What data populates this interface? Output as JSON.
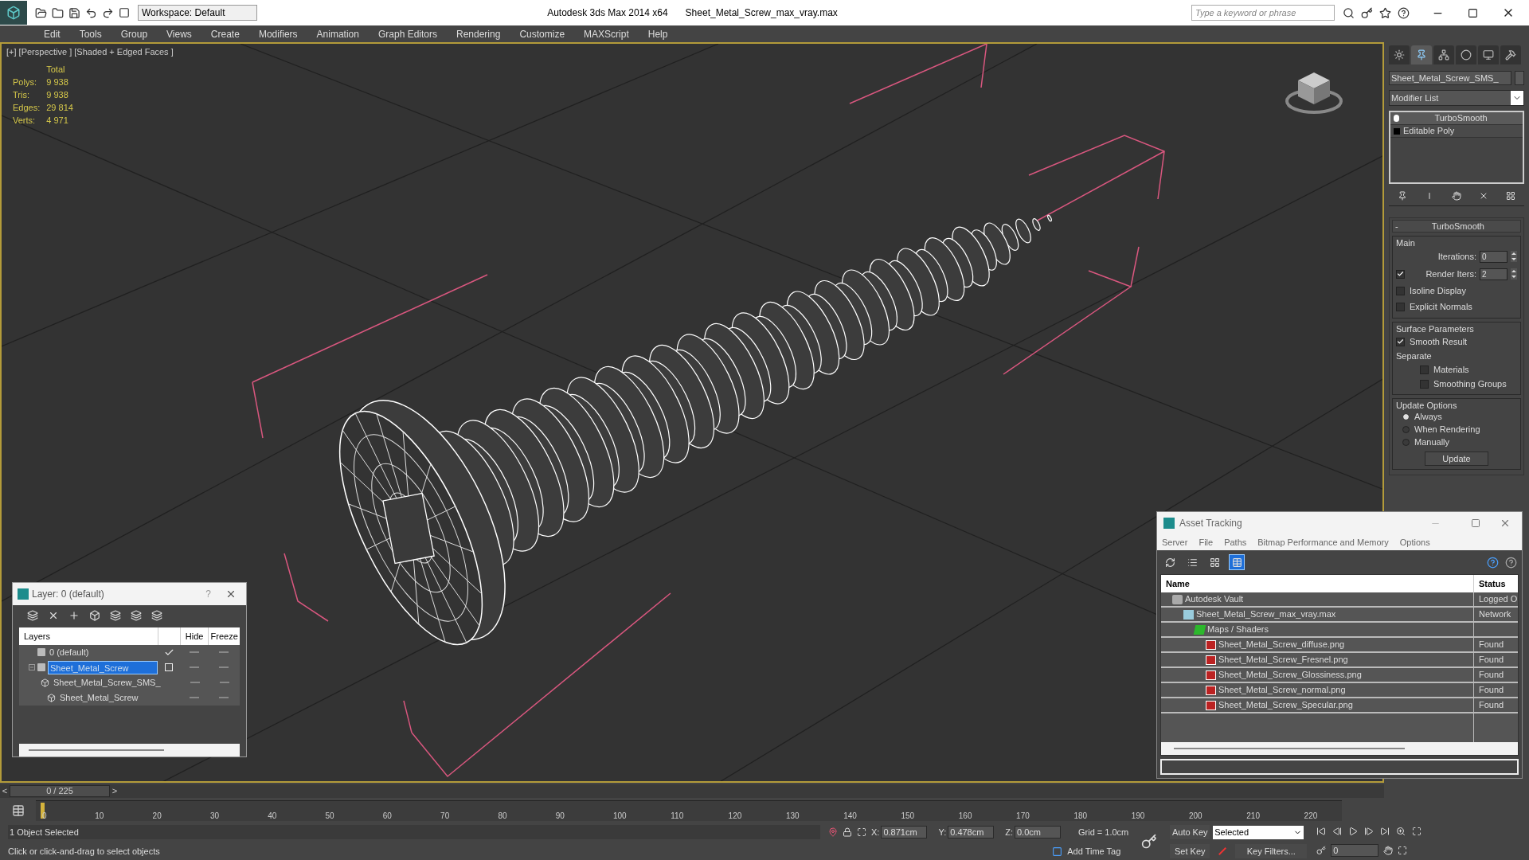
{
  "title_bar": {
    "workspace": "Workspace: Default",
    "app": "Autodesk 3ds Max  2014 x64",
    "file": "Sheet_Metal_Screw_max_vray.max",
    "search": {
      "placeholder": "Type a keyword or phrase"
    }
  },
  "menu": [
    "Edit",
    "Tools",
    "Group",
    "Views",
    "Create",
    "Modifiers",
    "Animation",
    "Graph Editors",
    "Rendering",
    "Customize",
    "MAXScript",
    "Help"
  ],
  "viewport": {
    "label": "[+] [Perspective ] [Shaded + Edged Faces ]",
    "stats_header": "Total",
    "stats": [
      {
        "label": "Polys:",
        "value": "9 938"
      },
      {
        "label": "Tris:",
        "value": "9 938"
      },
      {
        "label": "Edges:",
        "value": "29 814"
      },
      {
        "label": "Verts:",
        "value": "4 971"
      }
    ]
  },
  "command_panel": {
    "tabs": [
      {
        "kind": "create",
        "selected": false
      },
      {
        "kind": "modify",
        "selected": true
      },
      {
        "kind": "hierarchy",
        "selected": false
      },
      {
        "kind": "motion",
        "selected": false
      },
      {
        "kind": "display",
        "selected": false
      },
      {
        "kind": "utilities",
        "selected": false
      }
    ],
    "object_name": "Sheet_Metal_Screw_SMS_",
    "modifier_list": "Modifier List",
    "stack": [
      {
        "name": "TurboSmooth",
        "kind": "modifier",
        "selected": true
      },
      {
        "name": "Editable Poly",
        "kind": "base",
        "selected": false
      }
    ],
    "rollout": {
      "collapse": "-",
      "title": "TurboSmooth",
      "groups": [
        {
          "title": "Main",
          "items": [
            {
              "kind": "spinner",
              "label": "Iterations:",
              "value": "0"
            },
            {
              "kind": "check_spinner",
              "label": "Render Iters:",
              "value": "2",
              "checked": true
            },
            {
              "kind": "checkbox",
              "label": "Isoline Display",
              "checked": false
            },
            {
              "kind": "checkbox",
              "label": "Explicit Normals",
              "checked": false
            }
          ]
        },
        {
          "title": "Surface Parameters",
          "items": [
            {
              "kind": "checkbox",
              "label": "Smooth Result",
              "checked": true
            },
            {
              "kind": "label",
              "label": "Separate"
            },
            {
              "kind": "subcheckbox",
              "label": "Materials",
              "checked": false
            },
            {
              "kind": "subcheckbox",
              "label": "Smoothing Groups",
              "checked": false
            }
          ]
        },
        {
          "title": "Update Options",
          "items": [
            {
              "kind": "radio",
              "label": "Always",
              "selected": true
            },
            {
              "kind": "radio",
              "label": "When Rendering",
              "selected": false
            },
            {
              "kind": "radio",
              "label": "Manually",
              "selected": false
            },
            {
              "kind": "button",
              "label": "Update"
            }
          ]
        }
      ]
    }
  },
  "layer_dialog": {
    "title": "Layer: 0 (default)",
    "help": "?",
    "columns": [
      "Layers",
      "Hide",
      "Freeze"
    ],
    "rows": [
      {
        "name": "0 (default)",
        "kind": "layer",
        "current": true,
        "selected": false
      },
      {
        "name": "Sheet_Metal_Screw",
        "kind": "layer",
        "current": false,
        "selected": true,
        "children": [
          {
            "name": "Sheet_Metal_Screw_SMS_",
            "kind": "object",
            "selected": false
          },
          {
            "name": "Sheet_Metal_Screw",
            "kind": "object",
            "selected": false
          }
        ]
      }
    ]
  },
  "asset_tracking": {
    "title": "Asset Tracking",
    "menu": [
      "Server",
      "File",
      "Paths",
      "Bitmap Performance and Memory",
      "Options"
    ],
    "toolbar": [
      {
        "kind": "refresh",
        "selected": false
      },
      {
        "kind": "list",
        "selected": false
      },
      {
        "kind": "tree",
        "selected": false
      },
      {
        "kind": "table",
        "selected": true
      }
    ],
    "columns": [
      "Name",
      "Status"
    ],
    "rows": [
      {
        "name": "Autodesk Vault",
        "kind": "vault",
        "status": "Logged O",
        "children": [
          {
            "name": "Sheet_Metal_Screw_max_vray.max",
            "kind": "max",
            "status": "Network",
            "children": [
              {
                "name": "Maps / Shaders",
                "kind": "folder",
                "children": [
                  {
                    "name": "Sheet_Metal_Screw_diffuse.png",
                    "kind": "png",
                    "status": "Found"
                  },
                  {
                    "name": "Sheet_Metal_Screw_Fresnel.png",
                    "kind": "png",
                    "status": "Found"
                  },
                  {
                    "name": "Sheet_Metal_Screw_Glossiness.png",
                    "kind": "png",
                    "status": "Found"
                  },
                  {
                    "name": "Sheet_Metal_Screw_normal.png",
                    "kind": "png",
                    "status": "Found"
                  },
                  {
                    "name": "Sheet_Metal_Screw_Specular.png",
                    "kind": "png",
                    "status": "Found"
                  }
                ]
              }
            ]
          }
        ]
      }
    ]
  },
  "timeline": {
    "prev": "<",
    "frame": "0 / 225",
    "next": ">",
    "ticks": [
      "0",
      "10",
      "20",
      "30",
      "40",
      "50",
      "60",
      "70",
      "80",
      "90",
      "100",
      "110",
      "120",
      "130",
      "140",
      "150",
      "160",
      "170",
      "180",
      "190",
      "200",
      "210",
      "220"
    ]
  },
  "status": {
    "selected": "1 Object Selected",
    "prompt": "Click or click-and-drag to select objects",
    "coords": [
      {
        "label": "X:",
        "value": "0.871cm"
      },
      {
        "label": "Y:",
        "value": "0.478cm"
      },
      {
        "label": "Z:",
        "value": "0.0cm"
      }
    ],
    "grid": "Grid = 1.0cm",
    "time_tag": "Add Time Tag",
    "auto_key": "Auto Key",
    "key_mode": "Selected",
    "set_key": "Set Key",
    "key_filters": "Key Filters...",
    "frame": "0"
  }
}
